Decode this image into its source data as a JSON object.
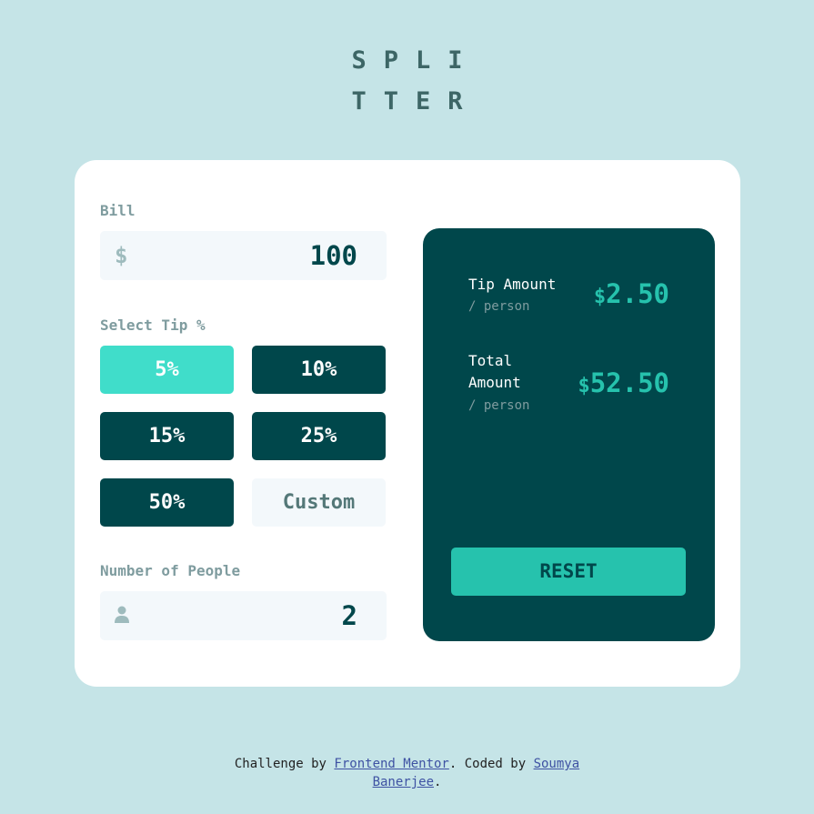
{
  "app": {
    "logo_line1": "SPLI",
    "logo_line2": "TTER"
  },
  "bill": {
    "label": "Bill",
    "currency_symbol": "$",
    "value": "100"
  },
  "tip": {
    "label": "Select Tip %",
    "options": [
      "5%",
      "10%",
      "15%",
      "25%",
      "50%"
    ],
    "selected": "5%",
    "custom_placeholder": "Custom"
  },
  "people": {
    "label": "Number of People",
    "value": "2"
  },
  "results": {
    "tip_label": "Tip Amount",
    "tip_sub": "/ person",
    "tip_currency": "$",
    "tip_value": "2.50",
    "total_label_line1": "Total",
    "total_label_line2": "Amount",
    "total_sub": "/ person",
    "total_currency": "$",
    "total_value": "52.50",
    "reset_label": "RESET"
  },
  "footer": {
    "prefix": "Challenge by ",
    "link1": "Frontend Mentor",
    "middle": ". Coded by ",
    "link2": "Soumya Banerjee",
    "suffix": "."
  },
  "colors": {
    "background": "#c5e4e7",
    "dark_cyan": "#00474b",
    "strong_cyan": "#26c2ad",
    "active_tip": "#40ddca"
  }
}
